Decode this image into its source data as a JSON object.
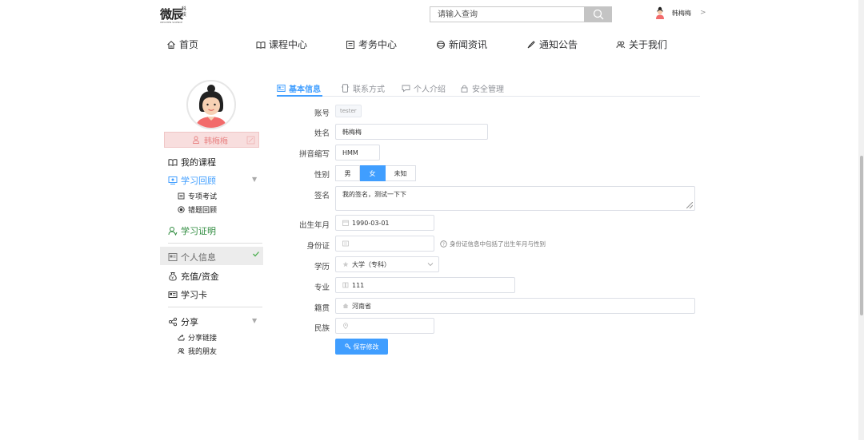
{
  "header": {
    "logo_main": "微辰",
    "logo_side": "科技",
    "logo_sub": "WEICHEN SCIENCE",
    "search_placeholder": "请输入查询",
    "username": "韩梅梅",
    "user_caret": ">"
  },
  "nav": [
    {
      "label": "首页",
      "icon": "home-icon"
    },
    {
      "label": "课程中心",
      "icon": "book-icon"
    },
    {
      "label": "考务中心",
      "icon": "exam-icon"
    },
    {
      "label": "新闻资讯",
      "icon": "news-icon"
    },
    {
      "label": "通知公告",
      "icon": "notice-icon"
    },
    {
      "label": "关于我们",
      "icon": "people-icon"
    }
  ],
  "sidebar": {
    "profile_name": "韩梅梅",
    "items": {
      "my_courses": "我的课程",
      "study_review": "学习回顾",
      "special_exam": "专项考试",
      "wrong_review": "错题回顾",
      "certificate": "学习证明",
      "personal_info": "个人信息",
      "recharge": "充值/资金",
      "study_card": "学习卡",
      "share": "分享",
      "share_link": "分享链接",
      "my_friends": "我的朋友"
    }
  },
  "tabs": [
    {
      "label": "基本信息",
      "active": true
    },
    {
      "label": "联系方式",
      "active": false
    },
    {
      "label": "个人介绍",
      "active": false
    },
    {
      "label": "安全管理",
      "active": false
    }
  ],
  "form": {
    "account_label": "账号",
    "account_value": "tester",
    "name_label": "姓名",
    "name_value": "韩梅梅",
    "pinyin_label": "拼音缩写",
    "pinyin_value": "HMM",
    "gender_label": "性别",
    "gender_options": [
      "男",
      "女",
      "未知"
    ],
    "gender_selected": "女",
    "signature_label": "签名",
    "signature_value": "我的签名，测试一下下",
    "birth_label": "出生年月",
    "birth_value": "1990-03-01",
    "id_label": "身份证",
    "id_value": "",
    "id_hint": "身份证信息中包括了出生年月与性别",
    "education_label": "学历",
    "education_value": "大学（专科）",
    "major_label": "专业",
    "major_value": "111",
    "origin_label": "籍贯",
    "origin_value": "河南省",
    "ethnic_label": "民族",
    "ethnic_value": "",
    "save_label": "保存修改"
  },
  "colors": {
    "primary": "#409eff",
    "name_bar": "#f8dede",
    "name_text": "#e88484"
  }
}
